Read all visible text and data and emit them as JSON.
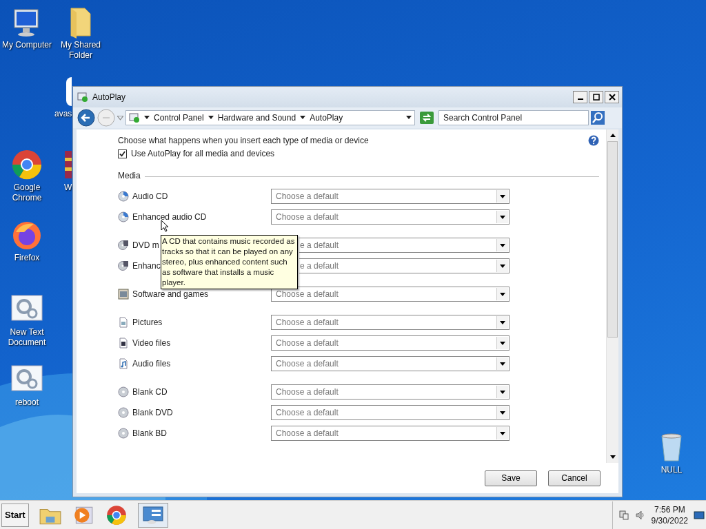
{
  "desktop_icons": [
    {
      "label": "My Computer"
    },
    {
      "label": "My Shared Folder"
    },
    {
      "label": "avas"
    },
    {
      "label": "Google Chrome"
    },
    {
      "label": "W"
    },
    {
      "label": "Firefox"
    },
    {
      "label": "New Text Document"
    },
    {
      "label": "reboot"
    },
    {
      "label": "NULL"
    }
  ],
  "window": {
    "title": "AutoPlay"
  },
  "address_bar": {
    "breadcrumbs": [
      "Control Panel",
      "Hardware and Sound",
      "AutoPlay"
    ],
    "search_placeholder": "Search Control Panel"
  },
  "intro": "Choose what happens when you insert each type of media or device",
  "use_autoplay": {
    "label": "Use AutoPlay for all media and devices",
    "checked": true
  },
  "section": "Media",
  "media_groups": [
    [
      {
        "kind": "cd",
        "label": "Audio CD",
        "value": "Choose a default"
      },
      {
        "kind": "cd",
        "label": "Enhanced audio CD",
        "value": "Choose a default"
      }
    ],
    [
      {
        "kind": "dvd",
        "label": "DVD m",
        "value": "e a default",
        "covered": true
      },
      {
        "kind": "dvd",
        "label": "Enhanc",
        "value": "e a default",
        "covered": true
      }
    ],
    [
      {
        "kind": "software",
        "label": "Software and games",
        "value": "Choose a default"
      }
    ],
    [
      {
        "kind": "pictures",
        "label": "Pictures",
        "value": "Choose a default"
      },
      {
        "kind": "video",
        "label": "Video files",
        "value": "Choose a default"
      },
      {
        "kind": "audio",
        "label": "Audio files",
        "value": "Choose a default"
      }
    ],
    [
      {
        "kind": "blank",
        "label": "Blank CD",
        "value": "Choose a default"
      },
      {
        "kind": "blank",
        "label": "Blank DVD",
        "value": "Choose a default"
      },
      {
        "kind": "blank",
        "label": "Blank BD",
        "value": "Choose a default"
      }
    ]
  ],
  "tooltip": "A CD that contains music recorded as tracks so that it can be played on any stereo, plus enhanced content such as software that installs a music player.",
  "buttons": [
    "Save",
    "Cancel"
  ],
  "taskbar": {
    "start": "Start",
    "time": "7:56 PM",
    "date": "9/30/2022"
  }
}
